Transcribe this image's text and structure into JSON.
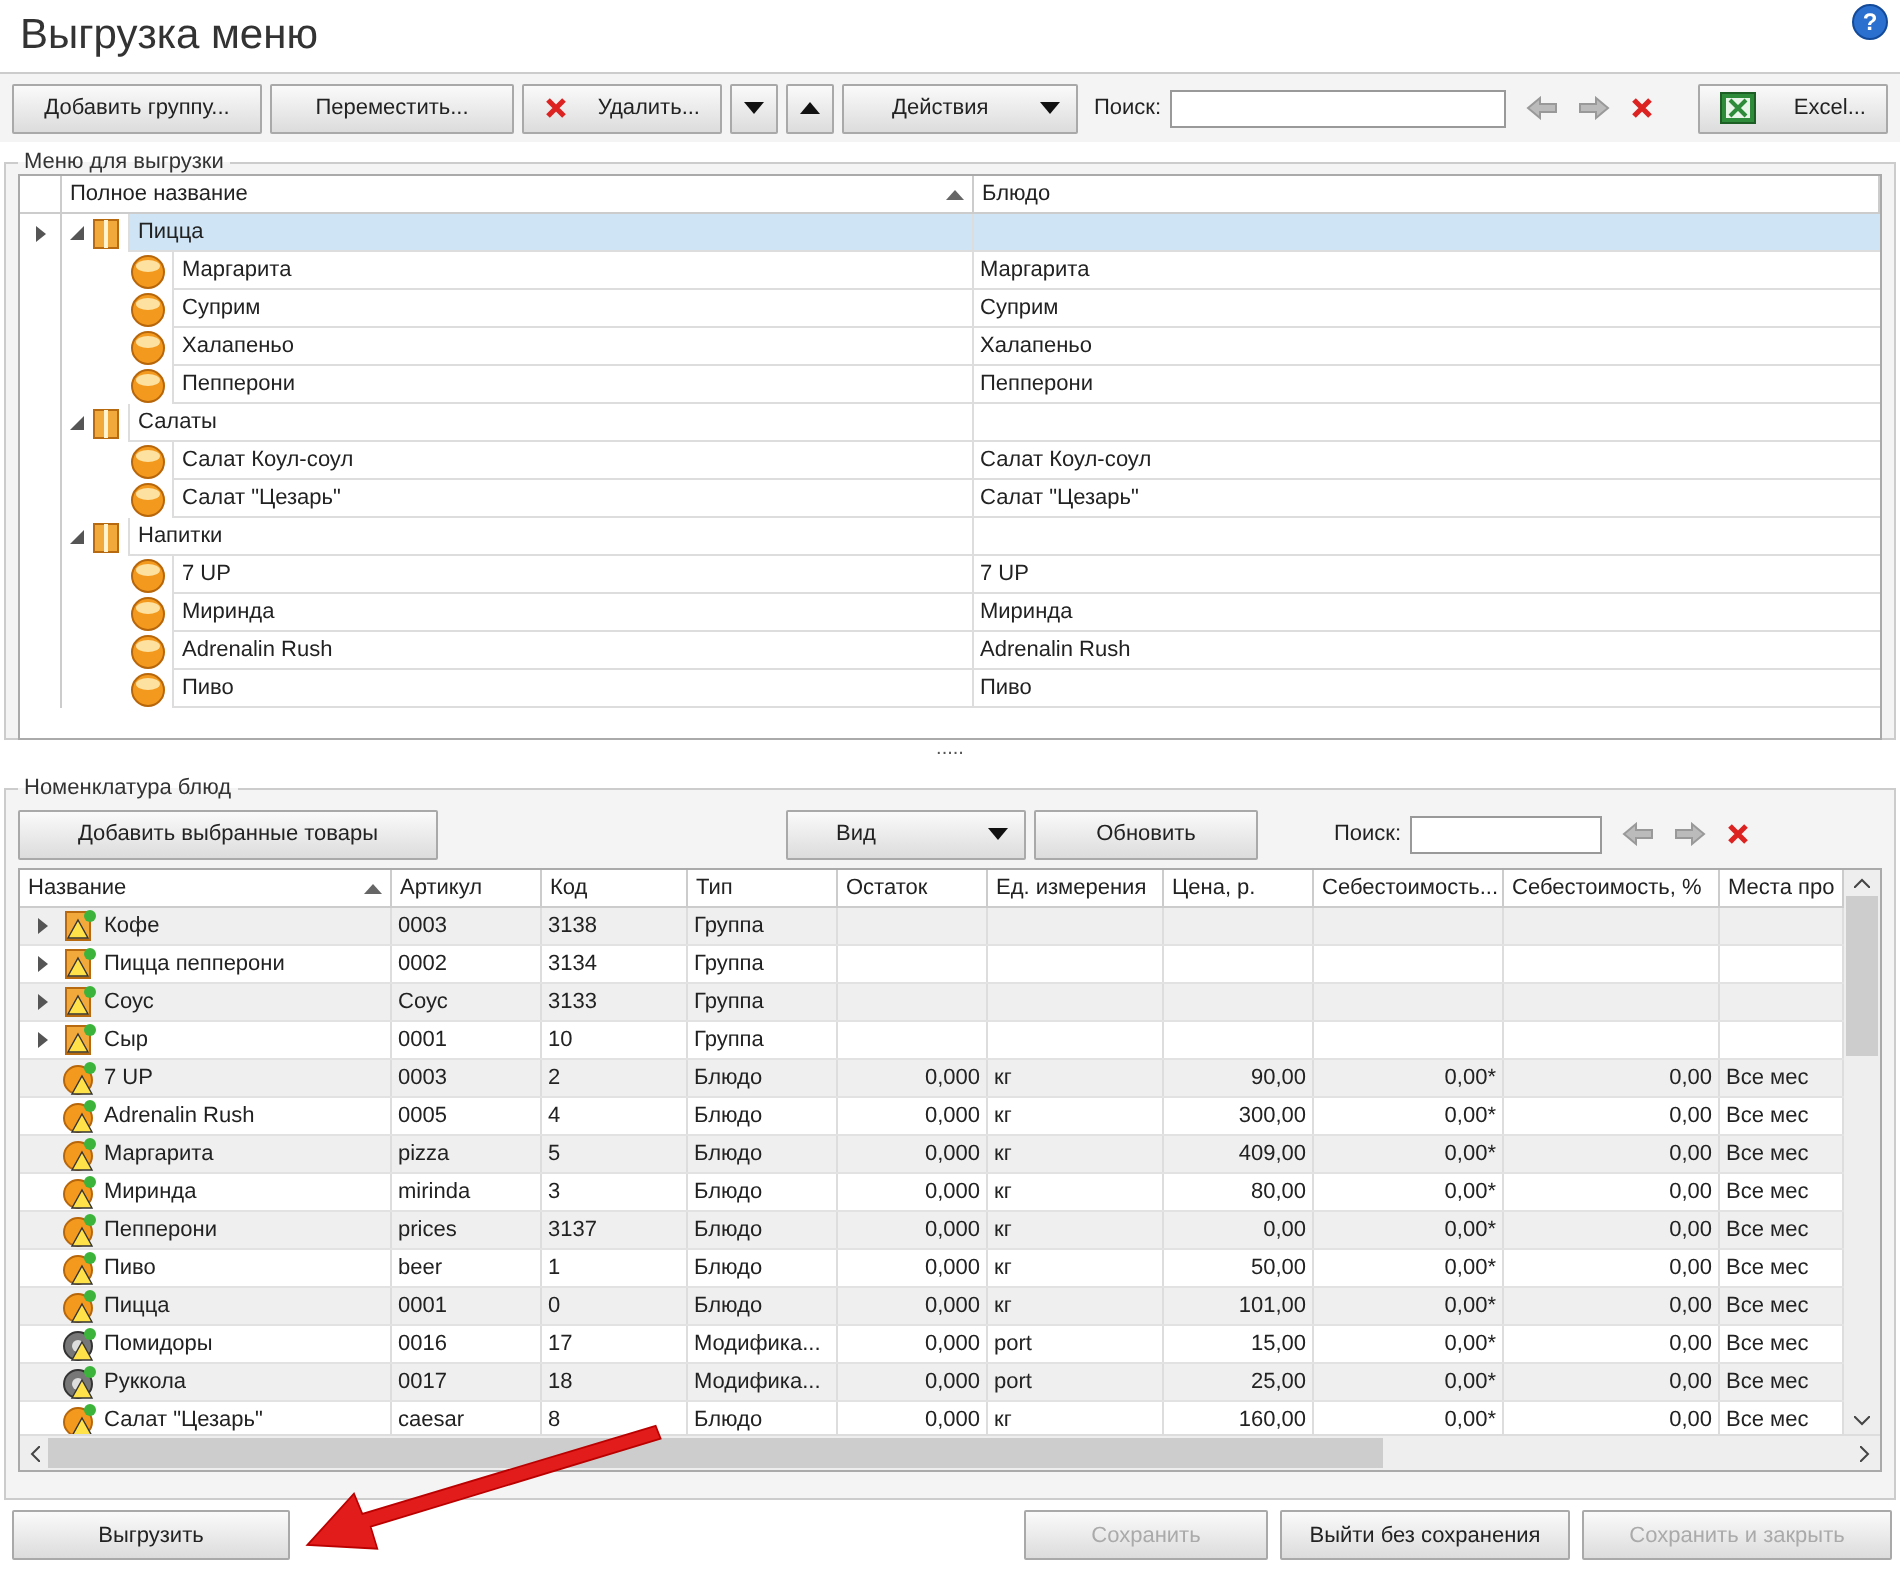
{
  "title": "Выгрузка меню",
  "help": "?",
  "toolbar": {
    "buttons": [
      {
        "kind": "text",
        "label": "Добавить группу..."
      },
      {
        "kind": "text",
        "label": "Переместить..."
      },
      {
        "kind": "delete",
        "label": "Удалить..."
      },
      {
        "kind": "down"
      },
      {
        "kind": "up"
      },
      {
        "kind": "menu",
        "label": "Действия"
      }
    ],
    "search_label": "Поиск:",
    "excel": "Excel..."
  },
  "menu_panel": {
    "title": "Меню для выгрузки",
    "columns": [
      {
        "label": "Полное название",
        "sorted": true
      },
      {
        "label": "Блюдо",
        "sorted": false
      }
    ],
    "groups": [
      {
        "name": "Пицца",
        "selected": true,
        "children": [
          {
            "name": "Маргарита",
            "dish": "Маргарита",
            "selected": false
          },
          {
            "name": "Суприм",
            "dish": "Суприм",
            "selected": false
          },
          {
            "name": "Халапеньо",
            "dish": "Халапеньо",
            "selected": false
          },
          {
            "name": "Пепперони",
            "dish": "Пепперони",
            "selected": false
          }
        ]
      },
      {
        "name": "Салаты",
        "selected": false,
        "children": [
          {
            "name": "Салат Коул-соул",
            "dish": "Салат Коул-соул",
            "selected": false
          },
          {
            "name": "Салат \"Цезарь\"",
            "dish": "Салат \"Цезарь\"",
            "selected": false
          }
        ]
      },
      {
        "name": "Напитки",
        "selected": false,
        "children": [
          {
            "name": "7 UP",
            "dish": "7 UP",
            "selected": false
          },
          {
            "name": "Миринда",
            "dish": "Миринда",
            "selected": false
          },
          {
            "name": "Adrenalin Rush",
            "dish": "Adrenalin Rush",
            "selected": false
          },
          {
            "name": "Пиво",
            "dish": "Пиво",
            "selected": false
          }
        ]
      }
    ]
  },
  "splitter": ".....",
  "catalog_panel": {
    "title": "Номенклатура блюд",
    "add_button": "Добавить выбранные товары",
    "view_button": "Вид",
    "refresh_button": "Обновить",
    "search_label": "Поиск:",
    "columns": [
      {
        "label": "Название",
        "sorted": true
      },
      {
        "label": "Артикул",
        "sorted": false
      },
      {
        "label": "Код",
        "sorted": false
      },
      {
        "label": "Тип",
        "sorted": false
      },
      {
        "label": "Остаток",
        "sorted": false
      },
      {
        "label": "Ед. измерения",
        "sorted": false
      },
      {
        "label": "Цена, р.",
        "sorted": false
      },
      {
        "label": "Себестоимость...",
        "sorted": false
      },
      {
        "label": "Себестоимость, %",
        "sorted": false
      },
      {
        "label": "Места про",
        "sorted": false
      }
    ],
    "rows": [
      {
        "kind": "group",
        "cells": [
          "Кофе",
          "0003",
          "3138",
          "Группа",
          "",
          "",
          "",
          "",
          "",
          ""
        ]
      },
      {
        "kind": "group",
        "cells": [
          "Пицца пепперони",
          "0002",
          "3134",
          "Группа",
          "",
          "",
          "",
          "",
          "",
          ""
        ]
      },
      {
        "kind": "group",
        "cells": [
          "Соус",
          "Соус",
          "3133",
          "Группа",
          "",
          "",
          "",
          "",
          "",
          ""
        ]
      },
      {
        "kind": "group",
        "cells": [
          "Сыр",
          "0001",
          "10",
          "Группа",
          "",
          "",
          "",
          "",
          "",
          ""
        ]
      },
      {
        "kind": "dish",
        "cells": [
          "7 UP",
          "0003",
          "2",
          "Блюдо",
          "0,000",
          "кг",
          "90,00",
          "0,00*",
          "0,00",
          "Все мес"
        ]
      },
      {
        "kind": "dish",
        "cells": [
          "Adrenalin Rush",
          "0005",
          "4",
          "Блюдо",
          "0,000",
          "кг",
          "300,00",
          "0,00*",
          "0,00",
          "Все мес"
        ]
      },
      {
        "kind": "dish",
        "cells": [
          "Маргарита",
          "pizza",
          "5",
          "Блюдо",
          "0,000",
          "кг",
          "409,00",
          "0,00*",
          "0,00",
          "Все мес"
        ]
      },
      {
        "kind": "dish",
        "cells": [
          "Миринда",
          "mirinda",
          "3",
          "Блюдо",
          "0,000",
          "кг",
          "80,00",
          "0,00*",
          "0,00",
          "Все мес"
        ]
      },
      {
        "kind": "dish",
        "cells": [
          "Пепперони",
          "prices",
          "3137",
          "Блюдо",
          "0,000",
          "кг",
          "0,00",
          "0,00*",
          "0,00",
          "Все мес"
        ]
      },
      {
        "kind": "dish",
        "cells": [
          "Пиво",
          "beer",
          "1",
          "Блюдо",
          "0,000",
          "кг",
          "50,00",
          "0,00*",
          "0,00",
          "Все мес"
        ]
      },
      {
        "kind": "dish",
        "cells": [
          "Пицца",
          "0001",
          "0",
          "Блюдо",
          "0,000",
          "кг",
          "101,00",
          "0,00*",
          "0,00",
          "Все мес"
        ]
      },
      {
        "kind": "modifier",
        "cells": [
          "Помидоры",
          "0016",
          "17",
          "Модифика...",
          "0,000",
          "port",
          "15,00",
          "0,00*",
          "0,00",
          "Все мес"
        ]
      },
      {
        "kind": "modifier",
        "cells": [
          "Руккола",
          "0017",
          "18",
          "Модифика...",
          "0,000",
          "port",
          "25,00",
          "0,00*",
          "0,00",
          "Все мес"
        ]
      },
      {
        "kind": "dish",
        "cells": [
          "Салат \"Цезарь\"",
          "caesar",
          "8",
          "Блюдо",
          "0,000",
          "кг",
          "160,00",
          "0,00*",
          "0,00",
          "Все мес"
        ]
      }
    ]
  },
  "footer": {
    "buttons": [
      {
        "label": "Выгрузить",
        "disabled": false
      },
      {
        "label": "Сохранить",
        "disabled": true
      },
      {
        "label": "Выйти без сохранения",
        "disabled": false
      },
      {
        "label": "Сохранить и закрыть",
        "disabled": true
      }
    ]
  }
}
